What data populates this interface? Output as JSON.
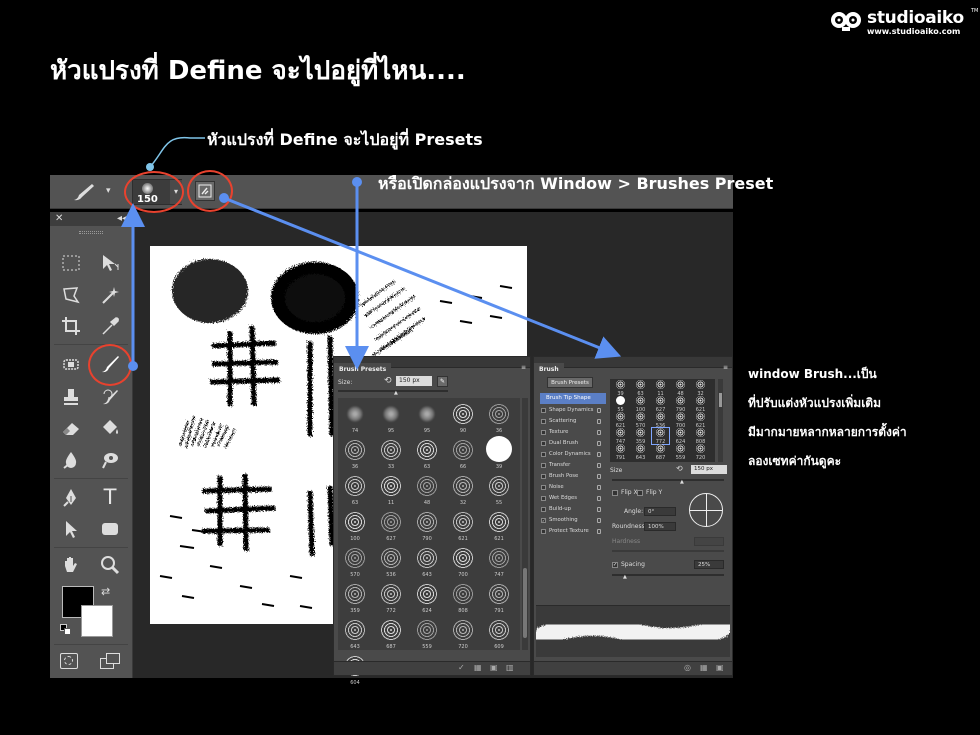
{
  "logo": {
    "name": "studioaiko",
    "url": "www.studioaiko.com",
    "tm": "TM"
  },
  "title": "หัวแปรงที่ Define จะไปอยู่ที่ไหน....",
  "callouts": {
    "presets": "หัวแปรงที่ Define จะไปอยู่ที่ Presets",
    "window": "หรือเปิดกล่องแปรงจาก Window > Brushes Preset"
  },
  "side_note": {
    "line1": "window Brush...เป็น",
    "line2": "ที่ปรับแต่งหัวแปรงเพิ่มเติม",
    "line3": "มีมากมายหลากหลายการตั้งค่า",
    "line4": "ลองเซทค่ากันดูคะ"
  },
  "options_bar": {
    "brush_size": "150"
  },
  "tool_panel": {
    "close": "✕",
    "collapse": "◂◂"
  },
  "brush_presets": {
    "tab": "Brush Presets",
    "size_label": "Size:",
    "size_value": "150 px",
    "sizes": [
      "74",
      "95",
      "95",
      "90",
      "36",
      "36",
      "33",
      "63",
      "66",
      "39",
      "63",
      "11",
      "48",
      "32",
      "55",
      "100",
      "627",
      "790",
      "621",
      "621",
      "570",
      "536",
      "643",
      "700",
      "747",
      "359",
      "772",
      "624",
      "808",
      "791",
      "643",
      "687",
      "559",
      "720",
      "609",
      "604"
    ]
  },
  "brush_panel": {
    "tab": "Brush",
    "presets_button": "Brush Presets",
    "tip_shape": "Brush Tip Shape",
    "options": [
      "Shape Dynamics",
      "Scattering",
      "Texture",
      "Dual Brush",
      "Color Dynamics",
      "Transfer",
      "Brush Pose",
      "Noise",
      "Wet Edges",
      "Build-up",
      "Smoothing",
      "Protect Texture"
    ],
    "sizes": [
      "39",
      "63",
      "11",
      "48",
      "32",
      "55",
      "100",
      "627",
      "790",
      "621",
      "621",
      "570",
      "536",
      "700",
      "621",
      "747",
      "359",
      "772",
      "624",
      "808",
      "791",
      "643",
      "687",
      "559",
      "720"
    ],
    "size_label": "Size",
    "size_value": "150 px",
    "flip_x": "Flip X",
    "flip_y": "Flip Y",
    "angle_label": "Angle:",
    "angle_value": "0°",
    "roundness_label": "Roundness:",
    "roundness_value": "100%",
    "hardness_label": "Hardness",
    "spacing_label": "Spacing",
    "spacing_value": "25%"
  },
  "colors": {
    "accent_blue": "#5b8ff0",
    "highlight_red": "#e8422e",
    "panel": "#4a4a4a",
    "chrome": "#535353"
  }
}
